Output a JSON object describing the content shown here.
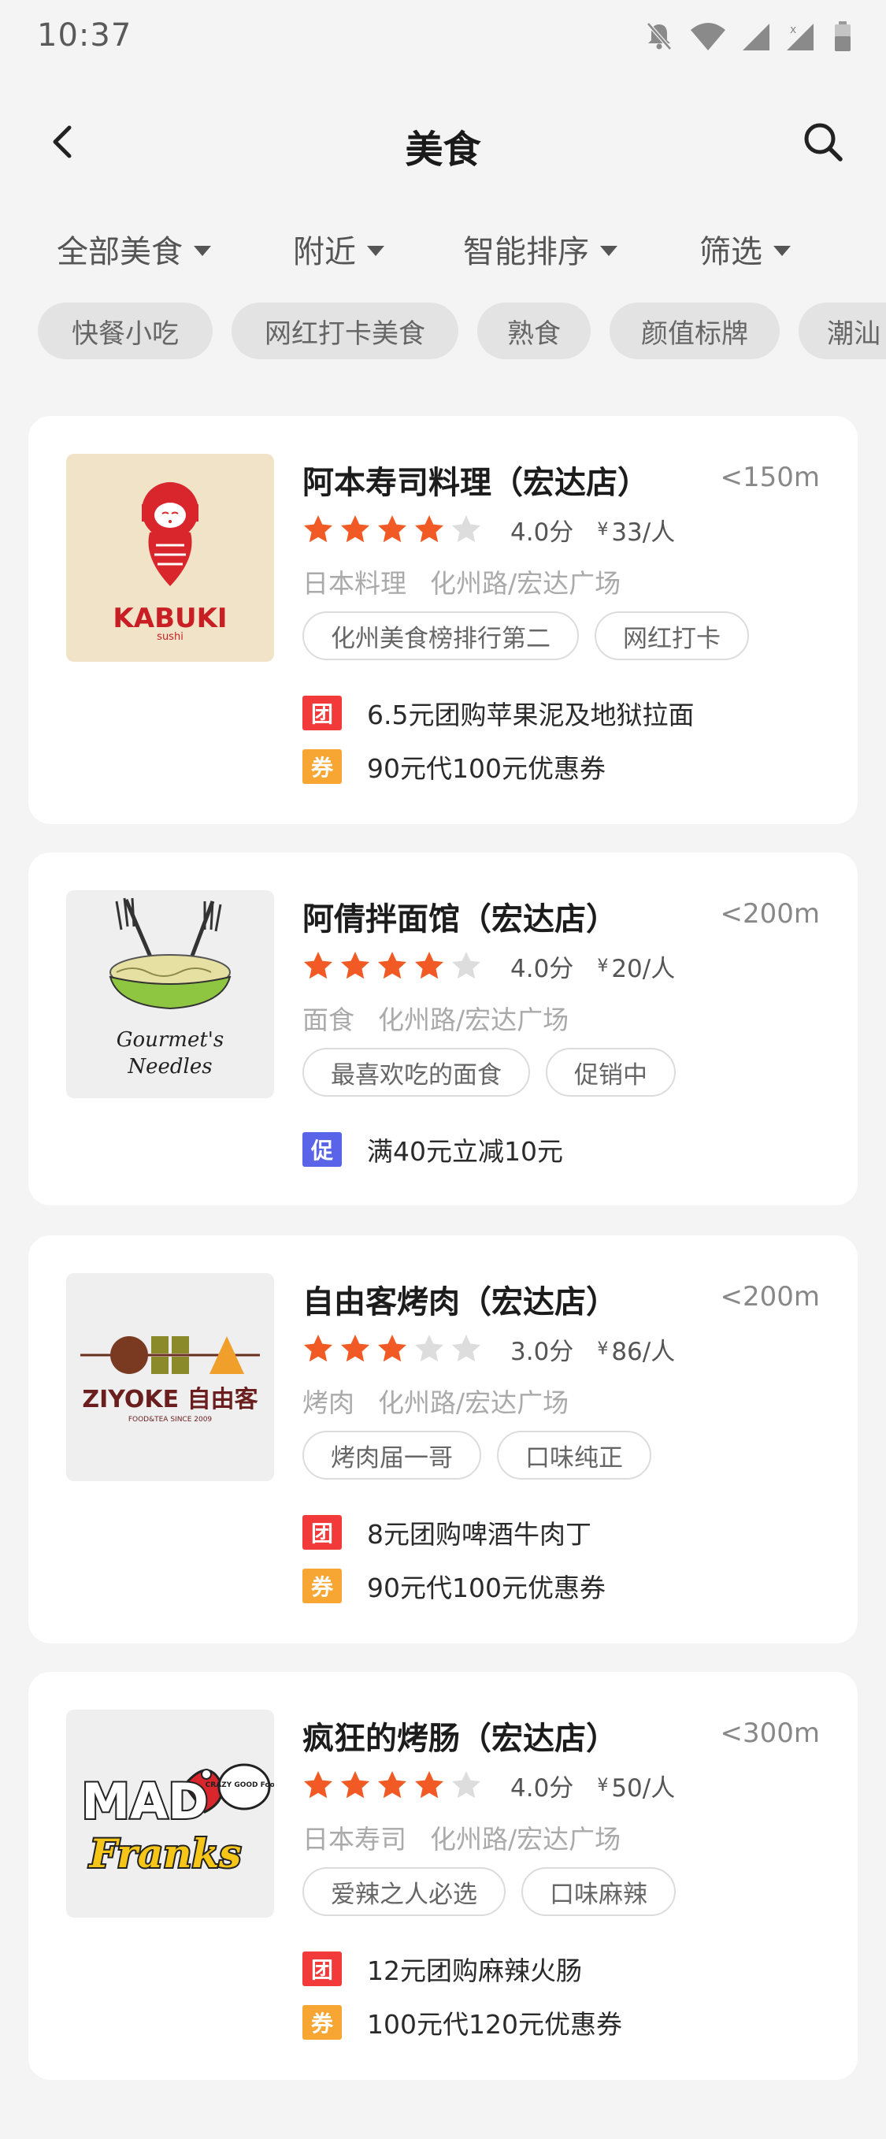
{
  "status": {
    "time": "10:37"
  },
  "nav": {
    "title": "美食"
  },
  "filters": [
    {
      "label": "全部美食"
    },
    {
      "label": "附近"
    },
    {
      "label": "智能排序"
    },
    {
      "label": "筛选"
    }
  ],
  "chips": [
    {
      "label": "快餐小吃"
    },
    {
      "label": "网红打卡美食"
    },
    {
      "label": "熟食"
    },
    {
      "label": "颜值标牌"
    },
    {
      "label": "潮汕"
    }
  ],
  "colors": {
    "star_on": "#f15a24",
    "star_off": "#dddddd",
    "badge_tuan": "#f23a3a",
    "badge_quan": "#f7a634",
    "badge_cu": "#5a64e8"
  },
  "restaurants": [
    {
      "name": "阿本寿司料理（宏达店）",
      "distance": "<150m",
      "stars": 4,
      "score": "4.0分",
      "yen": "¥",
      "price": "33/人",
      "category": "日本料理",
      "location": "化州路/宏达广场",
      "tags": [
        "化州美食榜排行第二",
        "网红打卡"
      ],
      "logo": {
        "text": "KABUKI",
        "sub": "sushi"
      },
      "promos": [
        {
          "badge": "团",
          "type": "tuan",
          "text": "6.5元团购苹果泥及地狱拉面"
        },
        {
          "badge": "券",
          "type": "quan",
          "text": "90元代100元优惠券"
        }
      ]
    },
    {
      "name": "阿倩拌面馆（宏达店）",
      "distance": "<200m",
      "stars": 4,
      "score": "4.0分",
      "yen": "¥",
      "price": "20/人",
      "category": "面食",
      "location": "化州路/宏达广场",
      "tags": [
        "最喜欢吃的面食",
        "促销中"
      ],
      "logo": {
        "text": "Gourmet's",
        "sub": "Needles"
      },
      "promos": [
        {
          "badge": "促",
          "type": "cu",
          "text": "满40元立减10元"
        }
      ]
    },
    {
      "name": "自由客烤肉（宏达店）",
      "distance": "<200m",
      "stars": 3,
      "score": "3.0分",
      "yen": "¥",
      "price": "86/人",
      "category": "烤肉",
      "location": "化州路/宏达广场",
      "tags": [
        "烤肉届一哥",
        "口味纯正"
      ],
      "logo": {
        "text": "ZIYOKE 自由客",
        "sub": "FOOD&TEA SINCE 2009"
      },
      "promos": [
        {
          "badge": "团",
          "type": "tuan",
          "text": "8元团购啤酒牛肉丁"
        },
        {
          "badge": "券",
          "type": "quan",
          "text": "90元代100元优惠券"
        }
      ]
    },
    {
      "name": "疯狂的烤肠（宏达店）",
      "distance": "<300m",
      "stars": 4,
      "score": "4.0分",
      "yen": "¥",
      "price": "50/人",
      "category": "日本寿司",
      "location": "化州路/宏达广场",
      "tags": [
        "爱辣之人必选",
        "口味麻辣"
      ],
      "logo": {
        "text": "MAD",
        "sub": "Franks",
        "bubble": "CRAZY GOOD Food!"
      },
      "promos": [
        {
          "badge": "团",
          "type": "tuan",
          "text": "12元团购麻辣火肠"
        },
        {
          "badge": "券",
          "type": "quan",
          "text": "100元代120元优惠券"
        }
      ]
    }
  ]
}
